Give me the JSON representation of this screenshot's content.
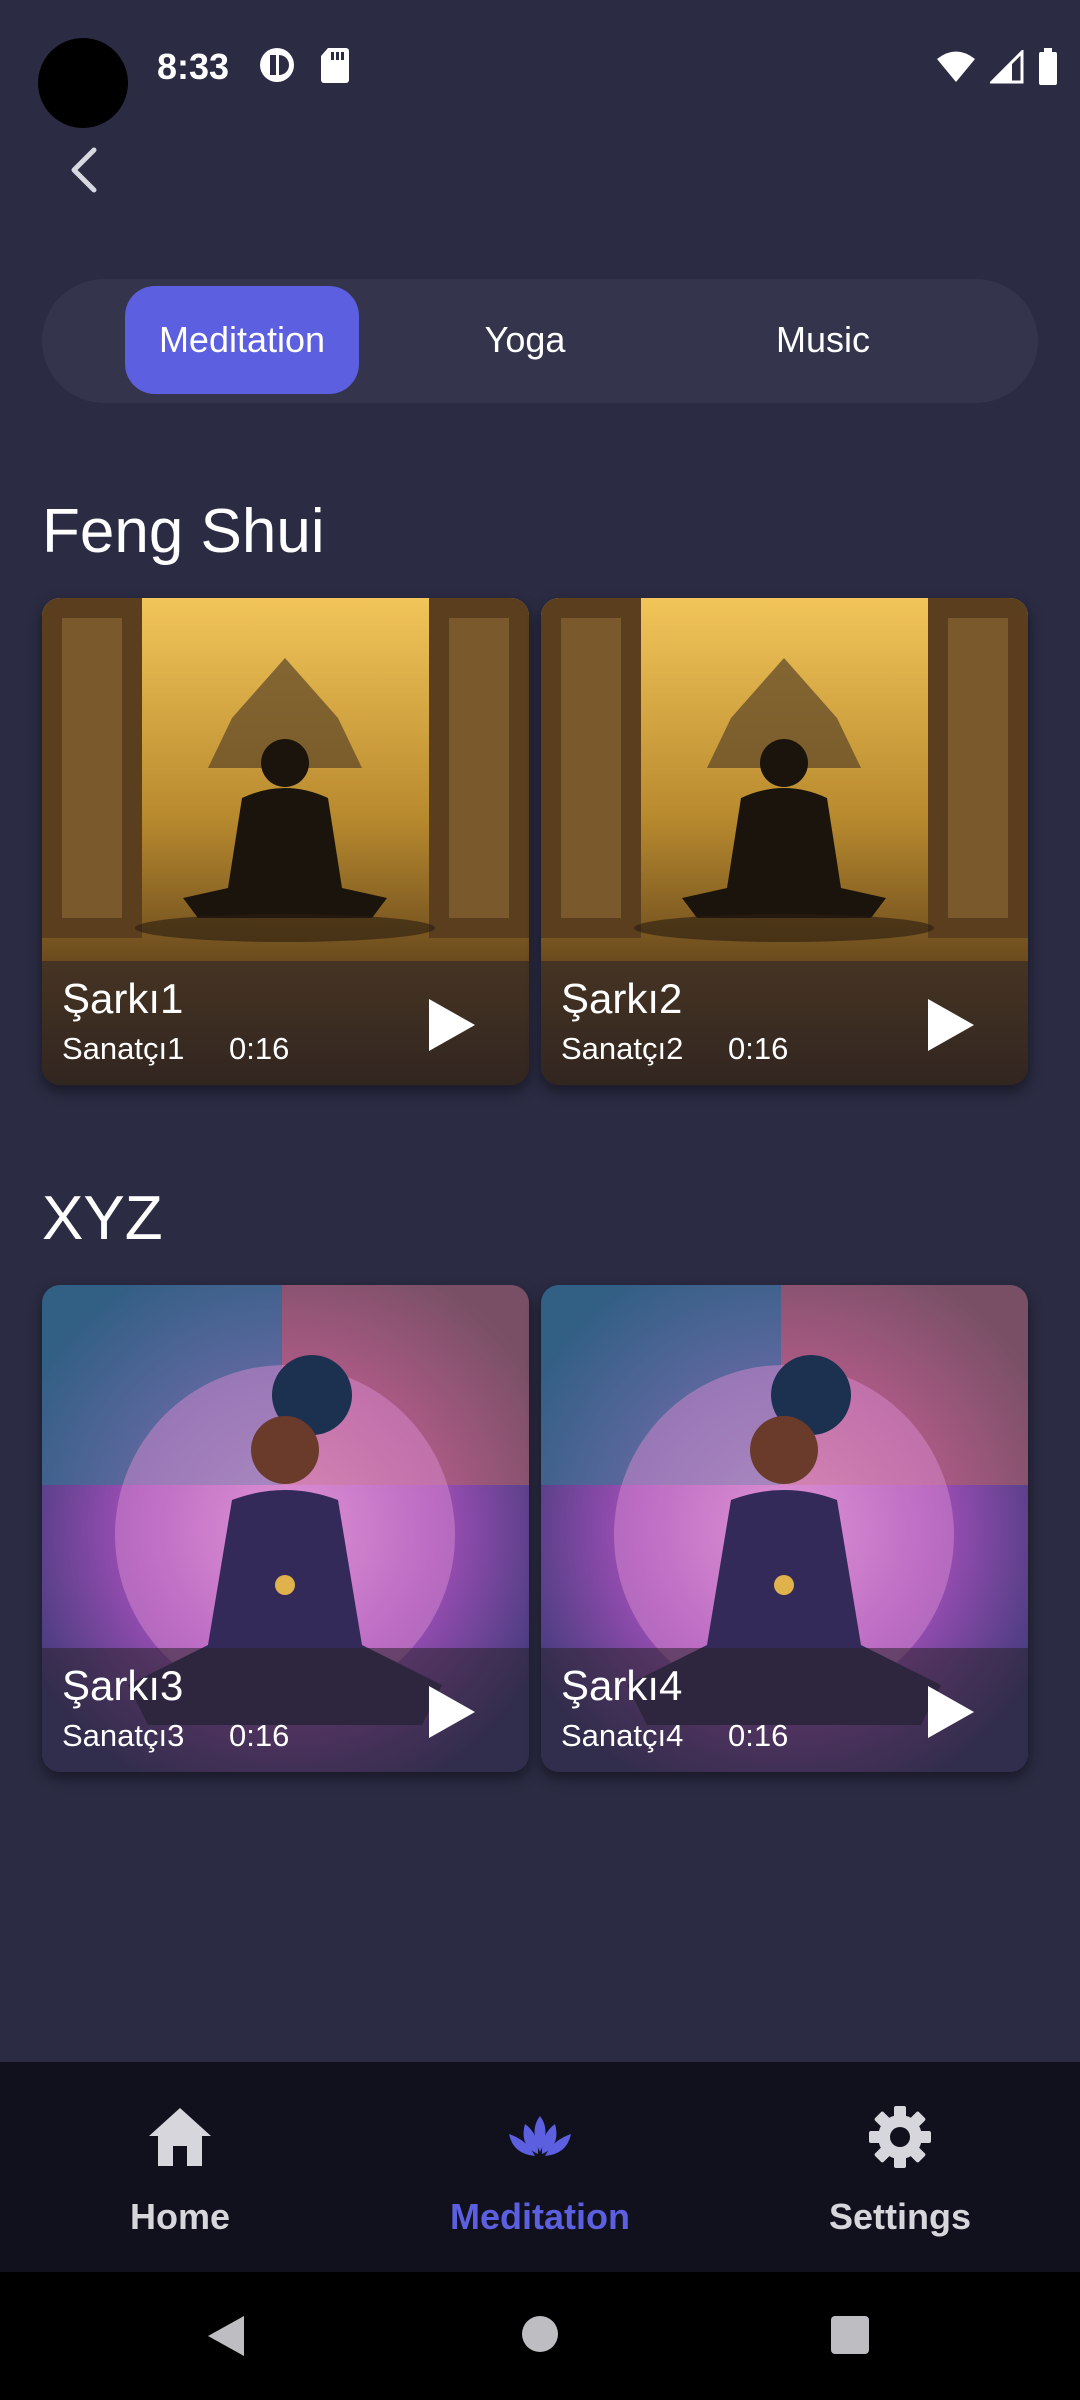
{
  "status_bar": {
    "time": "8:33"
  },
  "tabs": [
    {
      "label": "Meditation",
      "active": true
    },
    {
      "label": "Yoga",
      "active": false
    },
    {
      "label": "Music",
      "active": false
    }
  ],
  "sections": [
    {
      "title": "Feng Shui",
      "cards": [
        {
          "song": "Şarkı1",
          "artist": "Sanatçı1",
          "duration": "0:16"
        },
        {
          "song": "Şarkı2",
          "artist": "Sanatçı2",
          "duration": "0:16"
        }
      ]
    },
    {
      "title": "XYZ",
      "cards": [
        {
          "song": "Şarkı3",
          "artist": "Sanatçı3",
          "duration": "0:16"
        },
        {
          "song": "Şarkı4",
          "artist": "Sanatçı4",
          "duration": "0:16"
        }
      ]
    }
  ],
  "bottom_nav": [
    {
      "label": "Home",
      "icon": "home-icon",
      "active": false
    },
    {
      "label": "Meditation",
      "icon": "lotus-icon",
      "active": true
    },
    {
      "label": "Settings",
      "icon": "gear-icon",
      "active": false
    }
  ],
  "colors": {
    "background": "#2b2b43",
    "accent": "#5b5fe0",
    "nav_background": "#11111d"
  }
}
